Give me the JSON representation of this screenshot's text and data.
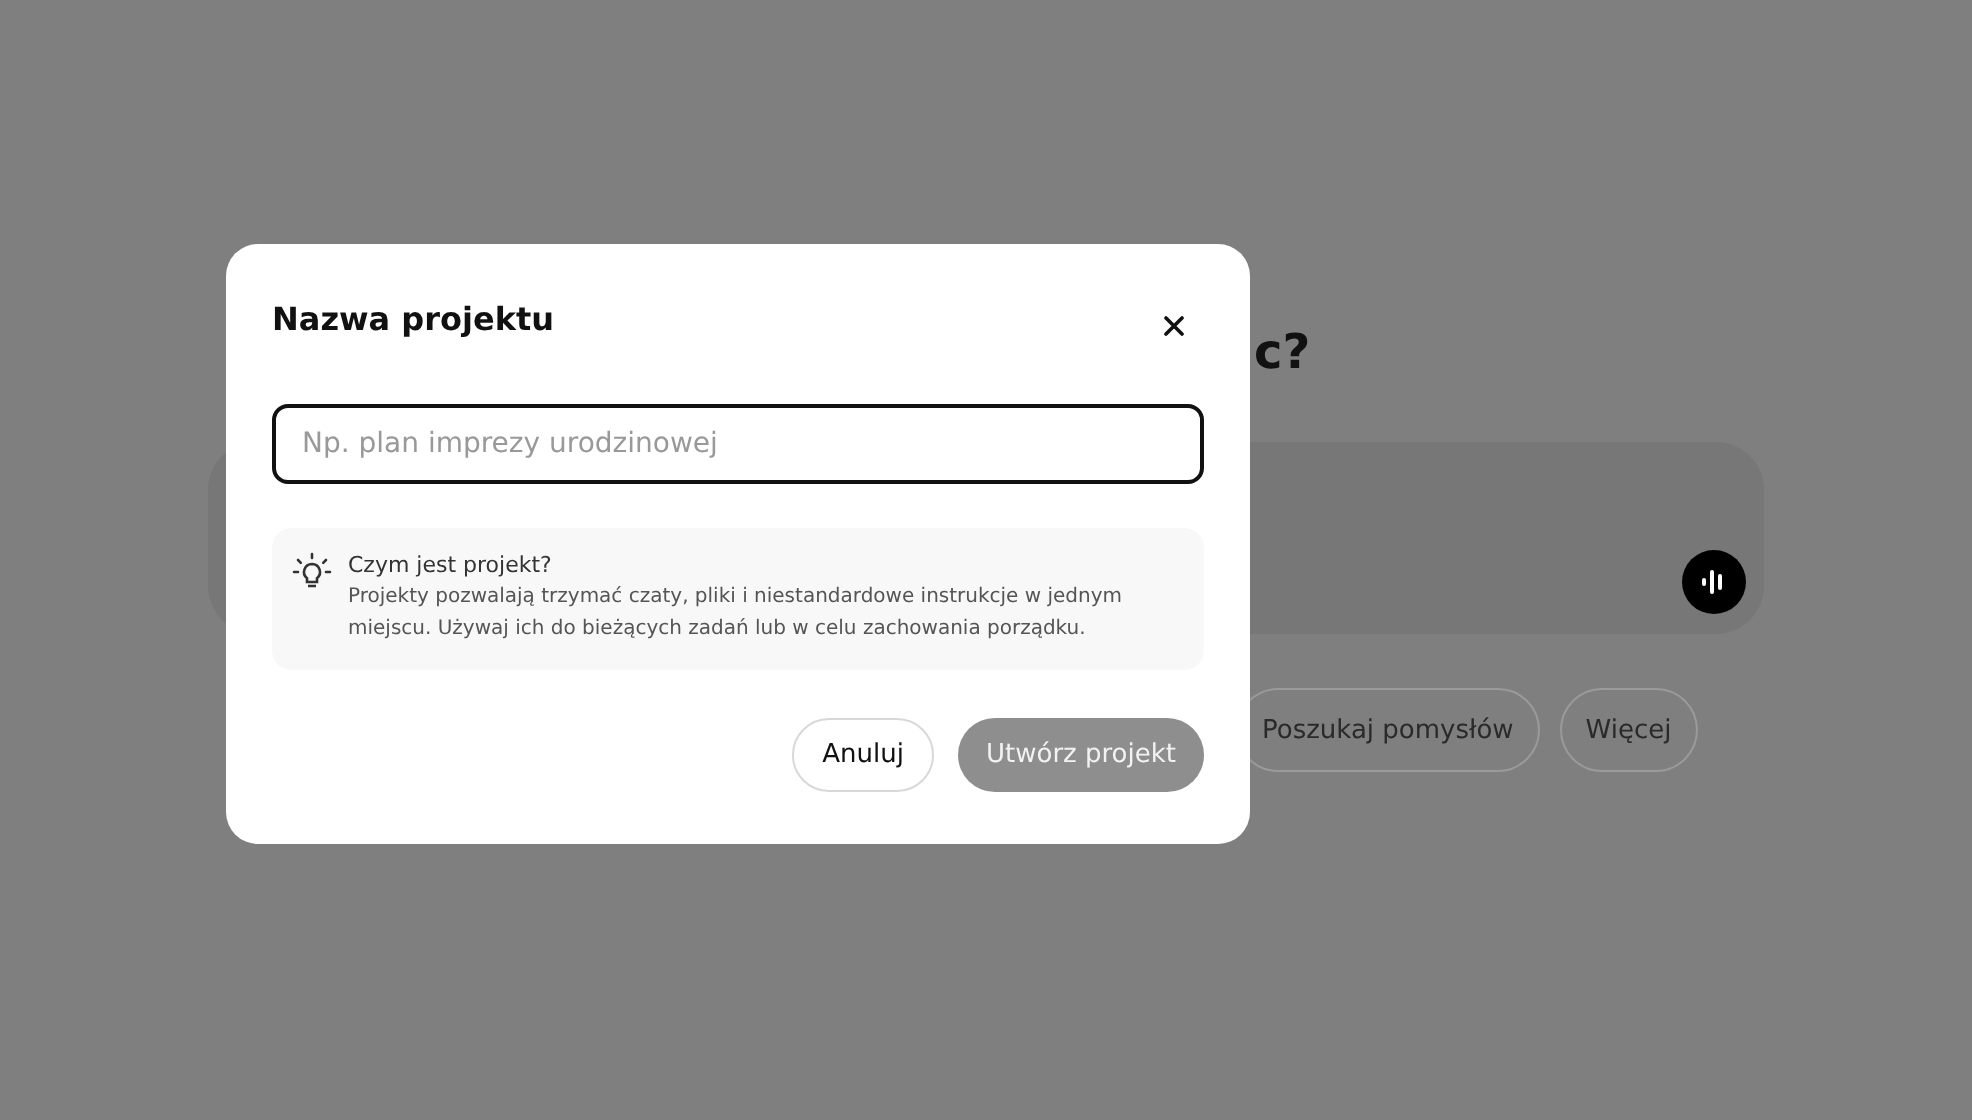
{
  "background": {
    "heading": "c?",
    "chips": [
      {
        "label": "Poszukaj pomysłów"
      },
      {
        "label": "Więcej"
      }
    ]
  },
  "dialog": {
    "title": "Nazwa projektu",
    "input": {
      "placeholder": "Np. plan imprezy urodzinowej"
    },
    "info": {
      "title": "Czym jest projekt?",
      "text": "Projekty pozwalają trzymać czaty, pliki i niestandardowe instrukcje w jednym miejscu. Używaj ich do bieżących zadań lub w celu zachowania porządku."
    },
    "buttons": [
      {
        "label": "Anuluj",
        "kind": "secondary",
        "disabled": false
      },
      {
        "label": "Utwórz projekt",
        "kind": "primary",
        "disabled": true
      }
    ]
  }
}
